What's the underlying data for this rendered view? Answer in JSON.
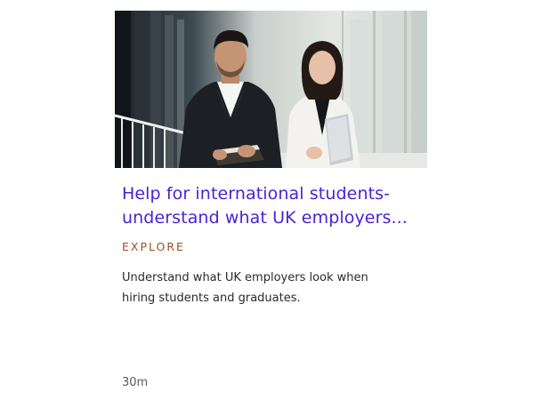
{
  "card": {
    "image": {
      "alt": "Two professionals standing in an office corridor holding a notebook and a folder"
    },
    "title": "Help for international students- understand what UK employers...",
    "tag": "EXPLORE",
    "description": "Understand what UK employers look when hiring students and graduates.",
    "duration": "30m"
  },
  "colors": {
    "title": "#4b22d6",
    "tag": "#a0501c",
    "text": "#2a2a2a",
    "muted": "#5a5a5a"
  }
}
